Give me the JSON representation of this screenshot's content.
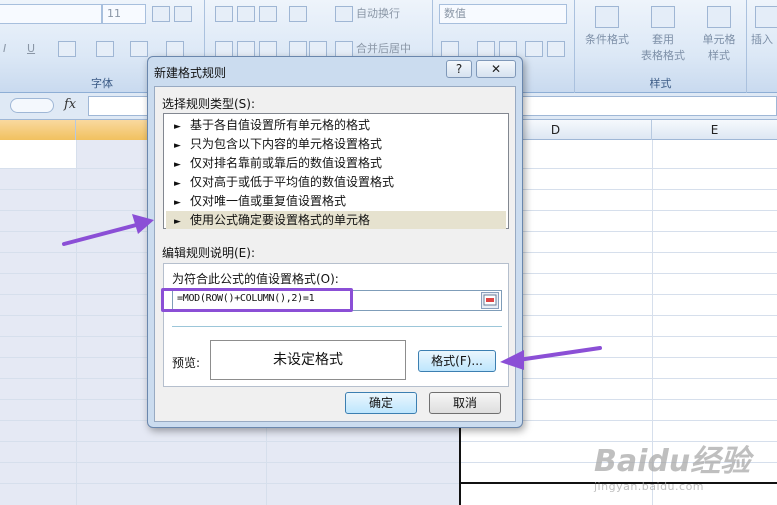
{
  "ribbon": {
    "font_size_value": "11",
    "number_format_value": "数值",
    "wrap_text_label": "自动换行",
    "merge_center_label": "合并后居中",
    "font_group_label": "字体",
    "styles_group_label": "样式",
    "conditional_format_label": "条件格式",
    "table_format_label_1": "套用",
    "table_format_label_2": "表格格式",
    "cell_styles_label_1": "单元格",
    "cell_styles_label_2": "样式",
    "insert_label": "插入",
    "underline_label": "U",
    "italic_label": "I"
  },
  "formula_bar": {
    "fx": "fx"
  },
  "columns": {
    "d": "D",
    "e": "E"
  },
  "dialog": {
    "title": "新建格式规则",
    "help_button": "?",
    "close_button": "✕",
    "rule_type_label": "选择规则类型(S):",
    "rule_types": [
      "基于各自值设置所有单元格的格式",
      "只为包含以下内容的单元格设置格式",
      "仅对排名靠前或靠后的数值设置格式",
      "仅对高于或低于平均值的数值设置格式",
      "仅对唯一值或重复值设置格式",
      "使用公式确定要设置格式的单元格"
    ],
    "rule_arrow": "►",
    "edit_label": "编辑规则说明(E):",
    "formula_prompt": "为符合此公式的值设置格式(O):",
    "formula_value": "=MOD(ROW()+COLUMN(),2)=1",
    "preview_label": "预览:",
    "preview_text": "未设定格式",
    "format_button": "格式(F)...",
    "ok_button": "确定",
    "cancel_button": "取消"
  },
  "watermark": {
    "main": "Baidu经验",
    "sub": "jingyan.baidu.com"
  },
  "colors": {
    "annotation": "#8b4fd6",
    "ribbon": "#dce8f6"
  }
}
